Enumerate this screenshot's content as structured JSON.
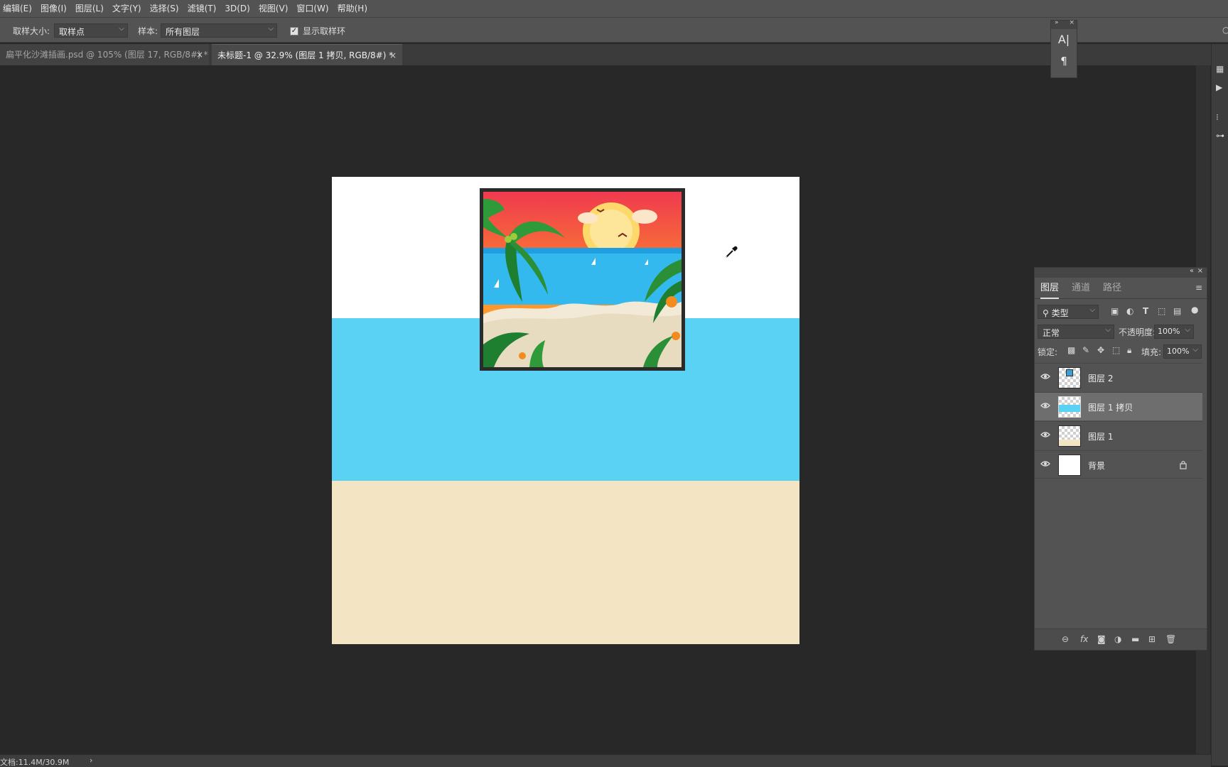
{
  "menu": [
    "编辑(E)",
    "图像(I)",
    "图层(L)",
    "文字(Y)",
    "选择(S)",
    "滤镜(T)",
    "3D(D)",
    "视图(V)",
    "窗口(W)",
    "帮助(H)"
  ],
  "options": {
    "sample_size_label": "取样大小:",
    "sample_size_value": "取样点",
    "sample_label": "样本:",
    "sample_value": "所有图层",
    "show_ring_label": "显示取样环",
    "show_ring_checked": true
  },
  "tabs": [
    {
      "title": "扁平化沙滩插画.psd @ 105% (图层 17, RGB/8#) *",
      "active": false
    },
    {
      "title": "未标题-1 @ 32.9% (图层 1 拷贝, RGB/8#) *",
      "active": true
    }
  ],
  "char_panel": {
    "char_icon": "A|",
    "para_icon": "¶"
  },
  "canvas": {
    "colors": {
      "white": "#ffffff",
      "sea": "#5ad2f4",
      "sand": "#f3e4c4",
      "frame": "#2b2b2b"
    }
  },
  "layers_panel": {
    "tabs": [
      "图层",
      "通道",
      "路径"
    ],
    "active_tab": "图层",
    "filter_value": "类型",
    "blend_mode": "正常",
    "opacity_label": "不透明度:",
    "opacity_value": "100%",
    "lock_label": "锁定:",
    "fill_label": "填充:",
    "fill_value": "100%",
    "layers": [
      {
        "name": "图层 2",
        "visible": true,
        "selected": false,
        "thumb": "art",
        "locked": false
      },
      {
        "name": "图层 1 拷贝",
        "visible": true,
        "selected": true,
        "thumb": "blue",
        "locked": false
      },
      {
        "name": "图层 1",
        "visible": true,
        "selected": false,
        "thumb": "sand",
        "locked": false
      },
      {
        "name": "背景",
        "visible": true,
        "selected": false,
        "thumb": "white",
        "locked": true
      }
    ]
  },
  "status": {
    "doc_info": "文档:11.4M/30.9M",
    "arrow": "›"
  }
}
